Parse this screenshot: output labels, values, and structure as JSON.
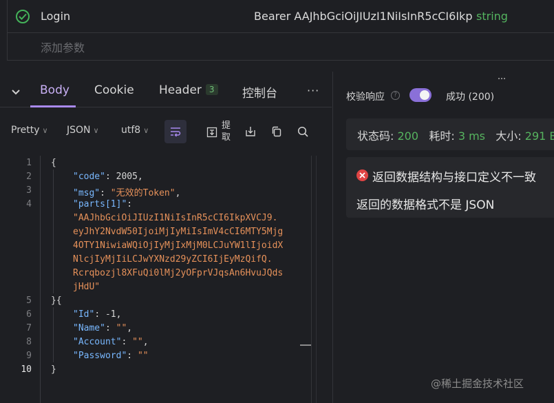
{
  "params": {
    "row": {
      "key": "Login",
      "value": "Bearer AAJhbGciOiJIUzI1NiIsInR5cCI6Ikp",
      "type": "string"
    },
    "add_param": "添加参数"
  },
  "tabs": {
    "body": "Body",
    "cookie": "Cookie",
    "header": "Header",
    "header_count": "3",
    "console": "控制台",
    "more": "···"
  },
  "toolbar": {
    "pretty": "Pretty",
    "format": "JSON",
    "encoding": "utf8",
    "extract": "提取"
  },
  "editor": {
    "line_numbers": [
      "1",
      "2",
      "3",
      "4",
      "5",
      "6",
      "7",
      "8",
      "9",
      "10"
    ],
    "lines": [
      {
        "type": "raw",
        "text": "{"
      },
      {
        "type": "kv",
        "key": "\"code\"",
        "value": "2005,",
        "vclass": "num"
      },
      {
        "type": "kv",
        "key": "\"msg\"",
        "value": "\"无效的Token\"",
        "vclass": "str",
        "tail": ","
      },
      {
        "type": "kv",
        "key": "\"parts[1]\"",
        "value": "",
        "vclass": "str"
      },
      {
        "type": "str",
        "text": "\"AAJhbGciOiJIUzI1NiIsInR5cCI6IkpXVCJ9."
      },
      {
        "type": "str",
        "text": "eyJhY2NvdW50IjoiMjIyMiIsImV4cCI6MTY5Mjg"
      },
      {
        "type": "str",
        "text": "4OTY1NiwiaWQiOjIyMjIxMjM0LCJuYW1lIjoidX"
      },
      {
        "type": "str",
        "text": "NlcjIyMjIiLCJwYXNzd29yZCI6IjEyMzQifQ."
      },
      {
        "type": "str",
        "text": "Rcrqbozjl8XFuQi0lMj2yOFprVJqsAn6HvuJQds"
      },
      {
        "type": "str",
        "text": "jHdU\""
      },
      {
        "type": "raw",
        "text": "}{"
      },
      {
        "type": "kv",
        "key": "\"Id\"",
        "value": "-1,",
        "vclass": "num"
      },
      {
        "type": "kv",
        "key": "\"Name\"",
        "value": "\"\"",
        "vclass": "str",
        "tail": ","
      },
      {
        "type": "kv",
        "key": "\"Account\"",
        "value": "\"\"",
        "vclass": "str",
        "tail": ","
      },
      {
        "type": "kv",
        "key": "\"Password\"",
        "value": "\"\"",
        "vclass": "str"
      },
      {
        "type": "raw",
        "text": "}"
      }
    ]
  },
  "response": {
    "validate_label": "校验响应",
    "validate_enabled": true,
    "success_label": "成功 (200)",
    "status_label": "状态码:",
    "status_value": "200",
    "time_label": "耗时:",
    "time_value": "3 ms",
    "size_label": "大小:",
    "size_value": "291 B",
    "error_title": "返回数据结构与接口定义不一致",
    "error_detail": "返回的数据格式不是 JSON"
  },
  "watermark": "@稀土掘金技术社区",
  "colors": {
    "accent": "#a98af0",
    "success": "#56b45f",
    "error": "#e04444",
    "key": "#79b8ff",
    "string": "#e6915a"
  }
}
